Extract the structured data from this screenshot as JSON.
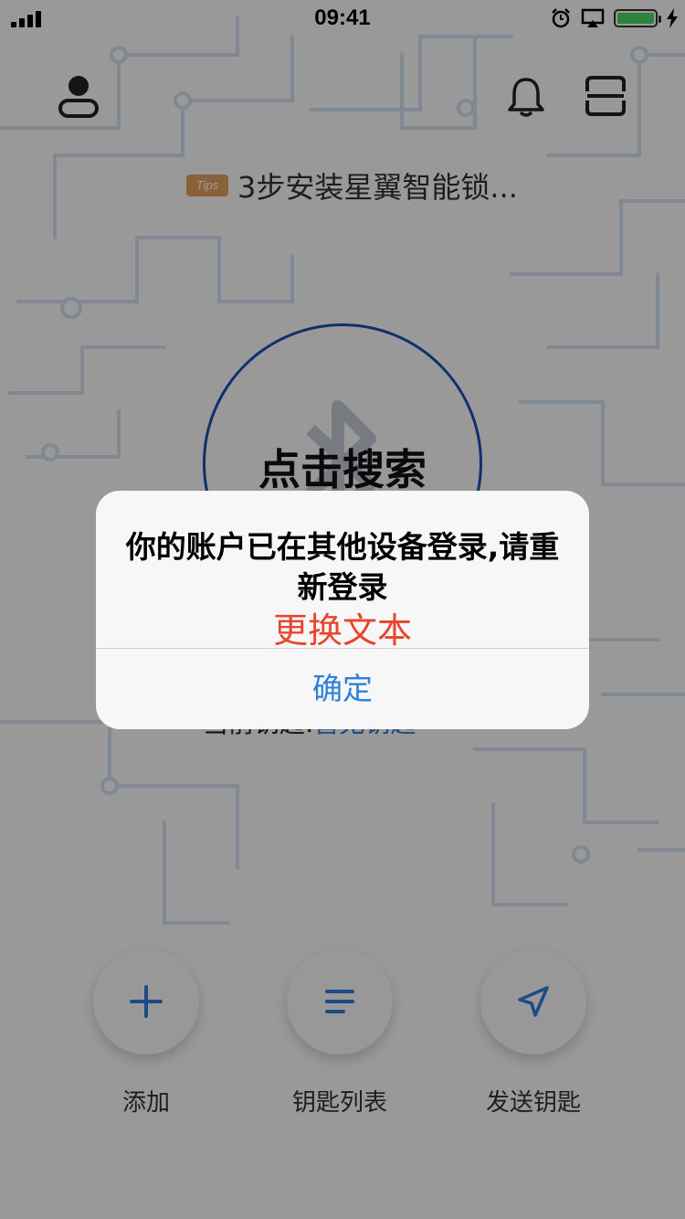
{
  "status_bar": {
    "time": "09:41"
  },
  "tips": {
    "badge": "Tips",
    "text": "3步安装星翼智能锁..."
  },
  "search": {
    "label": "点击搜索"
  },
  "current_key": {
    "label": "当前钥匙:",
    "value": "暂无钥匙"
  },
  "actions": [
    {
      "label": "添加",
      "icon": "plus-icon"
    },
    {
      "label": "钥匙列表",
      "icon": "list-icon"
    },
    {
      "label": "发送钥匙",
      "icon": "send-icon"
    }
  ],
  "alert": {
    "message": "你的账户已在其他设备登录,请重新登录",
    "sub_text": "更换文本",
    "confirm_label": "确定"
  },
  "colors": {
    "accent": "#2f7fde",
    "warning": "#e8442e",
    "circle": "#1a4fb8"
  }
}
